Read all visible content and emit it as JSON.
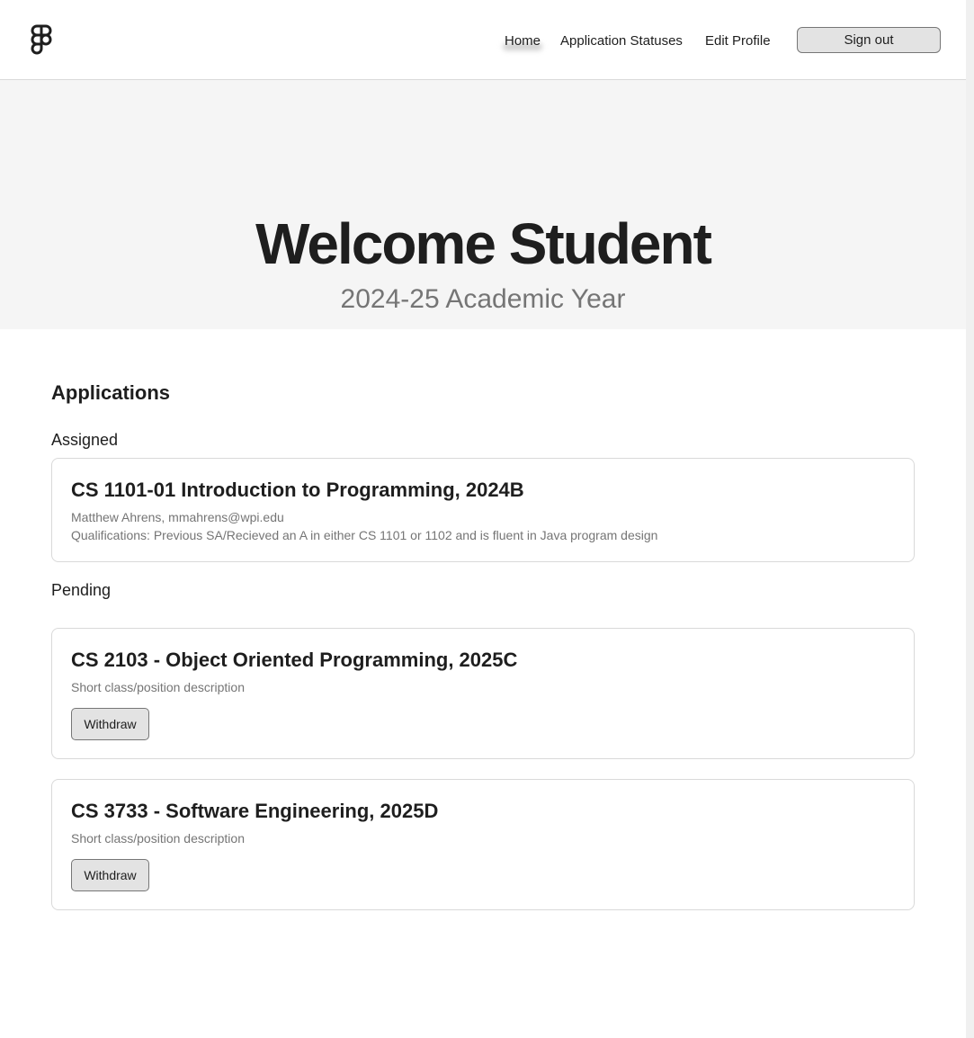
{
  "header": {
    "logo_icon": "figma-logo-icon",
    "nav": {
      "home": "Home",
      "application_statuses": "Application Statuses",
      "edit_profile": "Edit Profile"
    },
    "sign_out_label": "Sign out"
  },
  "hero": {
    "title": "Welcome Student",
    "subtitle": "2024-25 Academic Year"
  },
  "applications": {
    "heading": "Applications",
    "assigned_label": "Assigned",
    "assigned": [
      {
        "title": "CS 1101-01 Introduction to Programming, 2024B",
        "contact": "Matthew Ahrens, mmahrens@wpi.edu",
        "qualifications": "Qualifications: Previous SA/Recieved an A in either CS 1101 or 1102 and is fluent in Java program design"
      }
    ],
    "pending_label": "Pending",
    "pending": [
      {
        "title": "CS 2103 - Object Oriented Programming, 2025C",
        "description": "Short class/position description",
        "withdraw_label": "Withdraw"
      },
      {
        "title": "CS 3733 - Software Engineering, 2025D",
        "description": "Short class/position description",
        "withdraw_label": "Withdraw"
      }
    ]
  },
  "colors": {
    "text": "#1e1e1e",
    "muted": "#757575",
    "hero_bg": "#f5f5f5",
    "border": "#d9d9d9",
    "button_bg": "#e3e3e3"
  }
}
